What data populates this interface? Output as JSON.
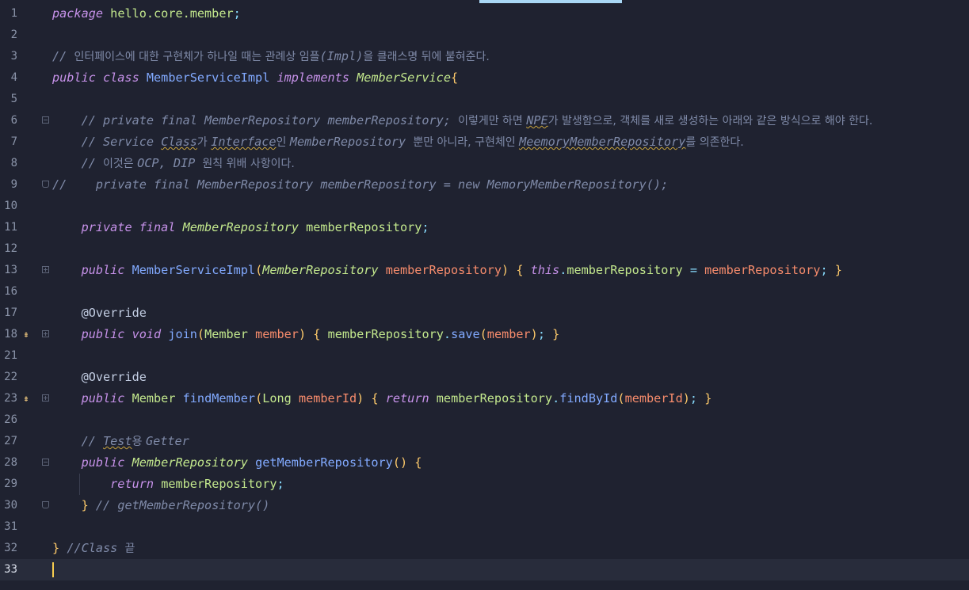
{
  "editor": {
    "current_line": "33",
    "lines": [
      {
        "n": "1",
        "segs": [
          [
            "kw",
            "package"
          ],
          [
            "plain",
            " "
          ],
          [
            "typ",
            "hello.core.member"
          ],
          [
            "pun",
            ";"
          ]
        ]
      },
      {
        "n": "2",
        "segs": []
      },
      {
        "n": "3",
        "segs": [
          [
            "cm",
            "// "
          ],
          [
            "cmk",
            "인터페이스에 대한 구현체가 하나일 때는 관례상 임플"
          ],
          [
            "cm",
            "(Impl)"
          ],
          [
            "cmk",
            "을 클래스명 뒤에 붙혀준다."
          ]
        ]
      },
      {
        "n": "4",
        "segs": [
          [
            "kw",
            "public class"
          ],
          [
            "plain",
            " "
          ],
          [
            "cls",
            "MemberServiceImpl"
          ],
          [
            "plain",
            " "
          ],
          [
            "kw",
            "implements"
          ],
          [
            "plain",
            " "
          ],
          [
            "typi",
            "MemberService"
          ],
          [
            "brk",
            "{"
          ]
        ]
      },
      {
        "n": "5",
        "segs": []
      },
      {
        "n": "6",
        "fold": "open",
        "segs": [
          [
            "plain",
            "    "
          ],
          [
            "cm",
            "// private final MemberRepository memberRepository; "
          ],
          [
            "cmk",
            "이렇게만 하면 "
          ],
          [
            "cm",
            "NPE",
            "wavy"
          ],
          [
            "cmk",
            "가 발생함으로, 객체를 새로 생성하는 아래와 같은 방식으로 해야 한다."
          ]
        ]
      },
      {
        "n": "7",
        "segs": [
          [
            "plain",
            "    "
          ],
          [
            "cm",
            "// Service "
          ],
          [
            "cm",
            "Class",
            "wavy"
          ],
          [
            "cmk",
            "가 "
          ],
          [
            "cm",
            "Interface",
            "wavy"
          ],
          [
            "cmk",
            "인 "
          ],
          [
            "cm",
            "MemberRepository "
          ],
          [
            "cmk",
            "뿐만 아니라, 구현체인 "
          ],
          [
            "cm",
            "MeemoryMemberRepository",
            "wavy"
          ],
          [
            "cmk",
            "를 의존한다."
          ]
        ]
      },
      {
        "n": "8",
        "segs": [
          [
            "plain",
            "    "
          ],
          [
            "cm",
            "// "
          ],
          [
            "cmk",
            "이것은 "
          ],
          [
            "cm",
            "OCP, DIP "
          ],
          [
            "cmk",
            "원칙 위배 사항이다."
          ]
        ]
      },
      {
        "n": "9",
        "fold": "end",
        "segs": [
          [
            "cm",
            "//    private final MemberRepository memberRepository = new MemoryMemberRepository();"
          ]
        ]
      },
      {
        "n": "10",
        "segs": []
      },
      {
        "n": "11",
        "segs": [
          [
            "plain",
            "    "
          ],
          [
            "kw",
            "private final"
          ],
          [
            "plain",
            " "
          ],
          [
            "typi",
            "MemberRepository"
          ],
          [
            "plain",
            " "
          ],
          [
            "fld",
            "memberRepository"
          ],
          [
            "pun",
            ";"
          ]
        ]
      },
      {
        "n": "12",
        "segs": []
      },
      {
        "n": "13",
        "fold": "plus",
        "segs": [
          [
            "plain",
            "    "
          ],
          [
            "kw",
            "public"
          ],
          [
            "plain",
            " "
          ],
          [
            "fn",
            "MemberServiceImpl"
          ],
          [
            "brk",
            "("
          ],
          [
            "typi",
            "MemberRepository"
          ],
          [
            "plain",
            " "
          ],
          [
            "prm",
            "memberRepository"
          ],
          [
            "brk",
            ")"
          ],
          [
            "plain",
            " "
          ],
          [
            "brk",
            "{"
          ],
          [
            "plain",
            " "
          ],
          [
            "kw",
            "this"
          ],
          [
            "pun",
            "."
          ],
          [
            "fld",
            "memberRepository"
          ],
          [
            "plain",
            " "
          ],
          [
            "pun",
            "="
          ],
          [
            "plain",
            " "
          ],
          [
            "prm",
            "memberRepository"
          ],
          [
            "pun",
            ";"
          ],
          [
            "plain",
            " "
          ],
          [
            "brk",
            "}"
          ]
        ]
      },
      {
        "n": "16",
        "segs": []
      },
      {
        "n": "17",
        "segs": [
          [
            "plain",
            "    "
          ],
          [
            "ann",
            "@Override"
          ]
        ]
      },
      {
        "n": "18",
        "mark": "impl-marker-icon",
        "fold": "plus",
        "segs": [
          [
            "plain",
            "    "
          ],
          [
            "kw",
            "public void"
          ],
          [
            "plain",
            " "
          ],
          [
            "fn",
            "join"
          ],
          [
            "brk",
            "("
          ],
          [
            "typ",
            "Member"
          ],
          [
            "plain",
            " "
          ],
          [
            "prm",
            "member"
          ],
          [
            "brk",
            ")"
          ],
          [
            "plain",
            " "
          ],
          [
            "brk",
            "{"
          ],
          [
            "plain",
            " "
          ],
          [
            "fld",
            "memberRepository"
          ],
          [
            "pun",
            "."
          ],
          [
            "fn",
            "save"
          ],
          [
            "brk",
            "("
          ],
          [
            "prm",
            "member"
          ],
          [
            "brk",
            ")"
          ],
          [
            "pun",
            ";"
          ],
          [
            "plain",
            " "
          ],
          [
            "brk",
            "}"
          ]
        ]
      },
      {
        "n": "21",
        "segs": []
      },
      {
        "n": "22",
        "segs": [
          [
            "plain",
            "    "
          ],
          [
            "ann",
            "@Override"
          ]
        ]
      },
      {
        "n": "23",
        "mark": "impl-marker-icon",
        "fold": "plus",
        "segs": [
          [
            "plain",
            "    "
          ],
          [
            "kw",
            "public"
          ],
          [
            "plain",
            " "
          ],
          [
            "typ",
            "Member"
          ],
          [
            "plain",
            " "
          ],
          [
            "fn",
            "findMember"
          ],
          [
            "brk",
            "("
          ],
          [
            "typ",
            "Long"
          ],
          [
            "plain",
            " "
          ],
          [
            "prm",
            "memberId"
          ],
          [
            "brk",
            ")"
          ],
          [
            "plain",
            " "
          ],
          [
            "brk",
            "{"
          ],
          [
            "plain",
            " "
          ],
          [
            "kw",
            "return"
          ],
          [
            "plain",
            " "
          ],
          [
            "fld",
            "memberRepository"
          ],
          [
            "pun",
            "."
          ],
          [
            "fn",
            "findById"
          ],
          [
            "brk",
            "("
          ],
          [
            "prm",
            "memberId"
          ],
          [
            "brk",
            ")"
          ],
          [
            "pun",
            ";"
          ],
          [
            "plain",
            " "
          ],
          [
            "brk",
            "}"
          ]
        ]
      },
      {
        "n": "26",
        "segs": []
      },
      {
        "n": "27",
        "segs": [
          [
            "plain",
            "    "
          ],
          [
            "cm",
            "// "
          ],
          [
            "cm",
            "Test",
            "wavy"
          ],
          [
            "cmk",
            "용 "
          ],
          [
            "cm",
            "Getter"
          ]
        ]
      },
      {
        "n": "28",
        "fold": "open",
        "segs": [
          [
            "plain",
            "    "
          ],
          [
            "kw",
            "public"
          ],
          [
            "plain",
            " "
          ],
          [
            "typi",
            "MemberRepository"
          ],
          [
            "plain",
            " "
          ],
          [
            "fn",
            "getMemberRepository"
          ],
          [
            "brk",
            "()"
          ],
          [
            "plain",
            " "
          ],
          [
            "brk",
            "{"
          ]
        ]
      },
      {
        "n": "29",
        "segs": [
          [
            "plain",
            "        "
          ],
          [
            "kw",
            "return"
          ],
          [
            "plain",
            " "
          ],
          [
            "fld",
            "memberRepository"
          ],
          [
            "pun",
            ";"
          ]
        ]
      },
      {
        "n": "30",
        "fold": "end",
        "segs": [
          [
            "plain",
            "    "
          ],
          [
            "brk",
            "}"
          ],
          [
            "plain",
            " "
          ],
          [
            "cm",
            "// getMemberRepository()"
          ]
        ]
      },
      {
        "n": "31",
        "segs": []
      },
      {
        "n": "32",
        "segs": [
          [
            "brk",
            "}"
          ],
          [
            "plain",
            " "
          ],
          [
            "cm",
            "//Class "
          ],
          [
            "cmk",
            "끝"
          ]
        ]
      },
      {
        "n": "33",
        "segs": []
      }
    ]
  }
}
